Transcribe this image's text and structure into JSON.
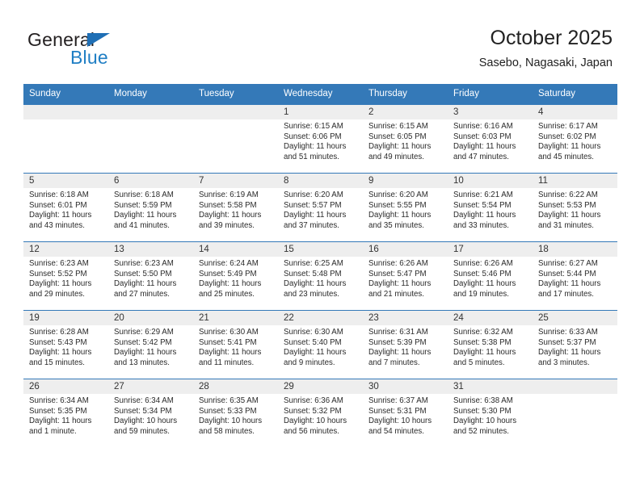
{
  "brand": {
    "word1": "General",
    "word2": "Blue",
    "triangle_color": "#1f6fb5",
    "blue_color": "#1f7ec4"
  },
  "header": {
    "title": "October 2025",
    "subtitle": "Sasebo, Nagasaki, Japan",
    "header_bg": "#3479b8"
  },
  "weekdays": [
    "Sunday",
    "Monday",
    "Tuesday",
    "Wednesday",
    "Thursday",
    "Friday",
    "Saturday"
  ],
  "labels": {
    "sunrise": "Sunrise:",
    "sunset": "Sunset:",
    "daylight": "Daylight:"
  },
  "weeks": [
    [
      {
        "day": "",
        "lines": []
      },
      {
        "day": "",
        "lines": []
      },
      {
        "day": "",
        "lines": []
      },
      {
        "day": "1",
        "lines": [
          "Sunrise: 6:15 AM",
          "Sunset: 6:06 PM",
          "Daylight: 11 hours",
          "and 51 minutes."
        ]
      },
      {
        "day": "2",
        "lines": [
          "Sunrise: 6:15 AM",
          "Sunset: 6:05 PM",
          "Daylight: 11 hours",
          "and 49 minutes."
        ]
      },
      {
        "day": "3",
        "lines": [
          "Sunrise: 6:16 AM",
          "Sunset: 6:03 PM",
          "Daylight: 11 hours",
          "and 47 minutes."
        ]
      },
      {
        "day": "4",
        "lines": [
          "Sunrise: 6:17 AM",
          "Sunset: 6:02 PM",
          "Daylight: 11 hours",
          "and 45 minutes."
        ]
      }
    ],
    [
      {
        "day": "5",
        "lines": [
          "Sunrise: 6:18 AM",
          "Sunset: 6:01 PM",
          "Daylight: 11 hours",
          "and 43 minutes."
        ]
      },
      {
        "day": "6",
        "lines": [
          "Sunrise: 6:18 AM",
          "Sunset: 5:59 PM",
          "Daylight: 11 hours",
          "and 41 minutes."
        ]
      },
      {
        "day": "7",
        "lines": [
          "Sunrise: 6:19 AM",
          "Sunset: 5:58 PM",
          "Daylight: 11 hours",
          "and 39 minutes."
        ]
      },
      {
        "day": "8",
        "lines": [
          "Sunrise: 6:20 AM",
          "Sunset: 5:57 PM",
          "Daylight: 11 hours",
          "and 37 minutes."
        ]
      },
      {
        "day": "9",
        "lines": [
          "Sunrise: 6:20 AM",
          "Sunset: 5:55 PM",
          "Daylight: 11 hours",
          "and 35 minutes."
        ]
      },
      {
        "day": "10",
        "lines": [
          "Sunrise: 6:21 AM",
          "Sunset: 5:54 PM",
          "Daylight: 11 hours",
          "and 33 minutes."
        ]
      },
      {
        "day": "11",
        "lines": [
          "Sunrise: 6:22 AM",
          "Sunset: 5:53 PM",
          "Daylight: 11 hours",
          "and 31 minutes."
        ]
      }
    ],
    [
      {
        "day": "12",
        "lines": [
          "Sunrise: 6:23 AM",
          "Sunset: 5:52 PM",
          "Daylight: 11 hours",
          "and 29 minutes."
        ]
      },
      {
        "day": "13",
        "lines": [
          "Sunrise: 6:23 AM",
          "Sunset: 5:50 PM",
          "Daylight: 11 hours",
          "and 27 minutes."
        ]
      },
      {
        "day": "14",
        "lines": [
          "Sunrise: 6:24 AM",
          "Sunset: 5:49 PM",
          "Daylight: 11 hours",
          "and 25 minutes."
        ]
      },
      {
        "day": "15",
        "lines": [
          "Sunrise: 6:25 AM",
          "Sunset: 5:48 PM",
          "Daylight: 11 hours",
          "and 23 minutes."
        ]
      },
      {
        "day": "16",
        "lines": [
          "Sunrise: 6:26 AM",
          "Sunset: 5:47 PM",
          "Daylight: 11 hours",
          "and 21 minutes."
        ]
      },
      {
        "day": "17",
        "lines": [
          "Sunrise: 6:26 AM",
          "Sunset: 5:46 PM",
          "Daylight: 11 hours",
          "and 19 minutes."
        ]
      },
      {
        "day": "18",
        "lines": [
          "Sunrise: 6:27 AM",
          "Sunset: 5:44 PM",
          "Daylight: 11 hours",
          "and 17 minutes."
        ]
      }
    ],
    [
      {
        "day": "19",
        "lines": [
          "Sunrise: 6:28 AM",
          "Sunset: 5:43 PM",
          "Daylight: 11 hours",
          "and 15 minutes."
        ]
      },
      {
        "day": "20",
        "lines": [
          "Sunrise: 6:29 AM",
          "Sunset: 5:42 PM",
          "Daylight: 11 hours",
          "and 13 minutes."
        ]
      },
      {
        "day": "21",
        "lines": [
          "Sunrise: 6:30 AM",
          "Sunset: 5:41 PM",
          "Daylight: 11 hours",
          "and 11 minutes."
        ]
      },
      {
        "day": "22",
        "lines": [
          "Sunrise: 6:30 AM",
          "Sunset: 5:40 PM",
          "Daylight: 11 hours",
          "and 9 minutes."
        ]
      },
      {
        "day": "23",
        "lines": [
          "Sunrise: 6:31 AM",
          "Sunset: 5:39 PM",
          "Daylight: 11 hours",
          "and 7 minutes."
        ]
      },
      {
        "day": "24",
        "lines": [
          "Sunrise: 6:32 AM",
          "Sunset: 5:38 PM",
          "Daylight: 11 hours",
          "and 5 minutes."
        ]
      },
      {
        "day": "25",
        "lines": [
          "Sunrise: 6:33 AM",
          "Sunset: 5:37 PM",
          "Daylight: 11 hours",
          "and 3 minutes."
        ]
      }
    ],
    [
      {
        "day": "26",
        "lines": [
          "Sunrise: 6:34 AM",
          "Sunset: 5:35 PM",
          "Daylight: 11 hours",
          "and 1 minute."
        ]
      },
      {
        "day": "27",
        "lines": [
          "Sunrise: 6:34 AM",
          "Sunset: 5:34 PM",
          "Daylight: 10 hours",
          "and 59 minutes."
        ]
      },
      {
        "day": "28",
        "lines": [
          "Sunrise: 6:35 AM",
          "Sunset: 5:33 PM",
          "Daylight: 10 hours",
          "and 58 minutes."
        ]
      },
      {
        "day": "29",
        "lines": [
          "Sunrise: 6:36 AM",
          "Sunset: 5:32 PM",
          "Daylight: 10 hours",
          "and 56 minutes."
        ]
      },
      {
        "day": "30",
        "lines": [
          "Sunrise: 6:37 AM",
          "Sunset: 5:31 PM",
          "Daylight: 10 hours",
          "and 54 minutes."
        ]
      },
      {
        "day": "31",
        "lines": [
          "Sunrise: 6:38 AM",
          "Sunset: 5:30 PM",
          "Daylight: 10 hours",
          "and 52 minutes."
        ]
      },
      {
        "day": "",
        "lines": []
      }
    ]
  ]
}
